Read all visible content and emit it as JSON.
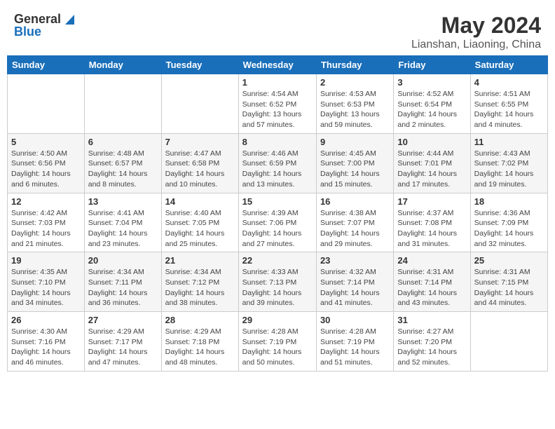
{
  "header": {
    "logo_general": "General",
    "logo_blue": "Blue",
    "title": "May 2024",
    "location": "Lianshan, Liaoning, China"
  },
  "weekdays": [
    "Sunday",
    "Monday",
    "Tuesday",
    "Wednesday",
    "Thursday",
    "Friday",
    "Saturday"
  ],
  "weeks": [
    [
      {
        "day": "",
        "info": ""
      },
      {
        "day": "",
        "info": ""
      },
      {
        "day": "",
        "info": ""
      },
      {
        "day": "1",
        "info": "Sunrise: 4:54 AM\nSunset: 6:52 PM\nDaylight: 13 hours and 57 minutes."
      },
      {
        "day": "2",
        "info": "Sunrise: 4:53 AM\nSunset: 6:53 PM\nDaylight: 13 hours and 59 minutes."
      },
      {
        "day": "3",
        "info": "Sunrise: 4:52 AM\nSunset: 6:54 PM\nDaylight: 14 hours and 2 minutes."
      },
      {
        "day": "4",
        "info": "Sunrise: 4:51 AM\nSunset: 6:55 PM\nDaylight: 14 hours and 4 minutes."
      }
    ],
    [
      {
        "day": "5",
        "info": "Sunrise: 4:50 AM\nSunset: 6:56 PM\nDaylight: 14 hours and 6 minutes."
      },
      {
        "day": "6",
        "info": "Sunrise: 4:48 AM\nSunset: 6:57 PM\nDaylight: 14 hours and 8 minutes."
      },
      {
        "day": "7",
        "info": "Sunrise: 4:47 AM\nSunset: 6:58 PM\nDaylight: 14 hours and 10 minutes."
      },
      {
        "day": "8",
        "info": "Sunrise: 4:46 AM\nSunset: 6:59 PM\nDaylight: 14 hours and 13 minutes."
      },
      {
        "day": "9",
        "info": "Sunrise: 4:45 AM\nSunset: 7:00 PM\nDaylight: 14 hours and 15 minutes."
      },
      {
        "day": "10",
        "info": "Sunrise: 4:44 AM\nSunset: 7:01 PM\nDaylight: 14 hours and 17 minutes."
      },
      {
        "day": "11",
        "info": "Sunrise: 4:43 AM\nSunset: 7:02 PM\nDaylight: 14 hours and 19 minutes."
      }
    ],
    [
      {
        "day": "12",
        "info": "Sunrise: 4:42 AM\nSunset: 7:03 PM\nDaylight: 14 hours and 21 minutes."
      },
      {
        "day": "13",
        "info": "Sunrise: 4:41 AM\nSunset: 7:04 PM\nDaylight: 14 hours and 23 minutes."
      },
      {
        "day": "14",
        "info": "Sunrise: 4:40 AM\nSunset: 7:05 PM\nDaylight: 14 hours and 25 minutes."
      },
      {
        "day": "15",
        "info": "Sunrise: 4:39 AM\nSunset: 7:06 PM\nDaylight: 14 hours and 27 minutes."
      },
      {
        "day": "16",
        "info": "Sunrise: 4:38 AM\nSunset: 7:07 PM\nDaylight: 14 hours and 29 minutes."
      },
      {
        "day": "17",
        "info": "Sunrise: 4:37 AM\nSunset: 7:08 PM\nDaylight: 14 hours and 31 minutes."
      },
      {
        "day": "18",
        "info": "Sunrise: 4:36 AM\nSunset: 7:09 PM\nDaylight: 14 hours and 32 minutes."
      }
    ],
    [
      {
        "day": "19",
        "info": "Sunrise: 4:35 AM\nSunset: 7:10 PM\nDaylight: 14 hours and 34 minutes."
      },
      {
        "day": "20",
        "info": "Sunrise: 4:34 AM\nSunset: 7:11 PM\nDaylight: 14 hours and 36 minutes."
      },
      {
        "day": "21",
        "info": "Sunrise: 4:34 AM\nSunset: 7:12 PM\nDaylight: 14 hours and 38 minutes."
      },
      {
        "day": "22",
        "info": "Sunrise: 4:33 AM\nSunset: 7:13 PM\nDaylight: 14 hours and 39 minutes."
      },
      {
        "day": "23",
        "info": "Sunrise: 4:32 AM\nSunset: 7:14 PM\nDaylight: 14 hours and 41 minutes."
      },
      {
        "day": "24",
        "info": "Sunrise: 4:31 AM\nSunset: 7:14 PM\nDaylight: 14 hours and 43 minutes."
      },
      {
        "day": "25",
        "info": "Sunrise: 4:31 AM\nSunset: 7:15 PM\nDaylight: 14 hours and 44 minutes."
      }
    ],
    [
      {
        "day": "26",
        "info": "Sunrise: 4:30 AM\nSunset: 7:16 PM\nDaylight: 14 hours and 46 minutes."
      },
      {
        "day": "27",
        "info": "Sunrise: 4:29 AM\nSunset: 7:17 PM\nDaylight: 14 hours and 47 minutes."
      },
      {
        "day": "28",
        "info": "Sunrise: 4:29 AM\nSunset: 7:18 PM\nDaylight: 14 hours and 48 minutes."
      },
      {
        "day": "29",
        "info": "Sunrise: 4:28 AM\nSunset: 7:19 PM\nDaylight: 14 hours and 50 minutes."
      },
      {
        "day": "30",
        "info": "Sunrise: 4:28 AM\nSunset: 7:19 PM\nDaylight: 14 hours and 51 minutes."
      },
      {
        "day": "31",
        "info": "Sunrise: 4:27 AM\nSunset: 7:20 PM\nDaylight: 14 hours and 52 minutes."
      },
      {
        "day": "",
        "info": ""
      }
    ]
  ]
}
